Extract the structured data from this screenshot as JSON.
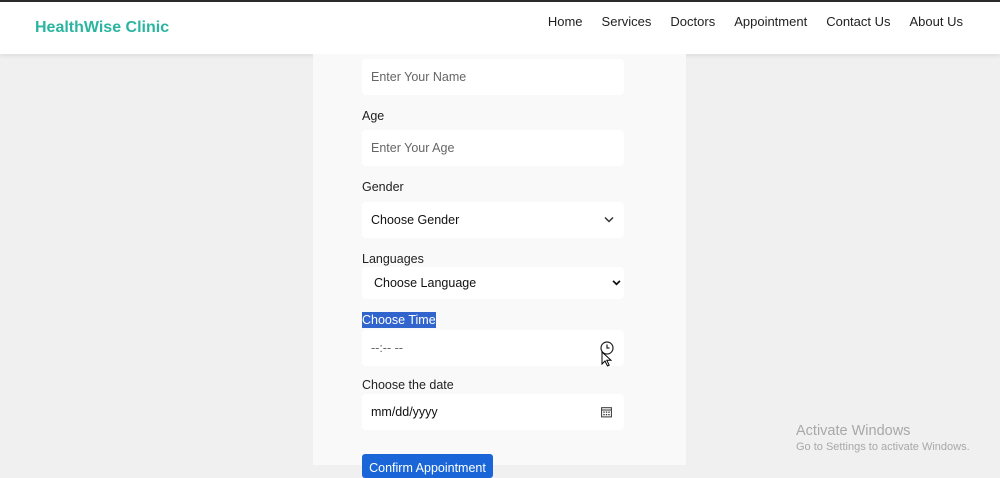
{
  "brand": {
    "name": "HealthWise Clinic",
    "color": "#2bb5a0"
  },
  "nav": {
    "items": [
      {
        "label": "Home"
      },
      {
        "label": "Services"
      },
      {
        "label": "Doctors"
      },
      {
        "label": "Appointment"
      },
      {
        "label": "Contact Us"
      },
      {
        "label": "About Us"
      }
    ]
  },
  "form": {
    "name": {
      "placeholder": "Enter Your Name"
    },
    "age": {
      "label": "Age",
      "placeholder": "Enter Your Age"
    },
    "gender": {
      "label": "Gender",
      "selected": "Choose Gender"
    },
    "language": {
      "label": "Languages",
      "selected": "Choose Language"
    },
    "time": {
      "label": "Choose Time",
      "value": "--:-- --",
      "icon": "clock-icon"
    },
    "date": {
      "label": "Choose the date",
      "value": "mm/dd/yyyy",
      "icon": "calendar-icon"
    },
    "submit": {
      "label": "Confirm Appointment",
      "color": "#1a66d8"
    }
  },
  "watermark": {
    "title": "Activate Windows",
    "subtitle": "Go to Settings to activate Windows."
  }
}
